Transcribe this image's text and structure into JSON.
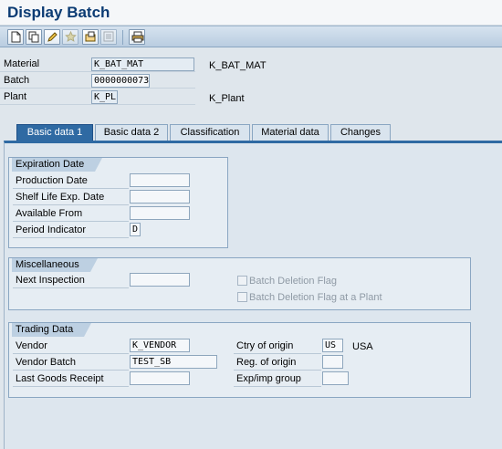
{
  "window": {
    "title": "Display Batch"
  },
  "toolbar": {
    "buttons": [
      {
        "icon": "new-document-icon",
        "enabled": true
      },
      {
        "icon": "copy-icon",
        "enabled": true
      },
      {
        "icon": "edit-pencil-icon",
        "enabled": true
      },
      {
        "icon": "star-icon",
        "enabled": false
      },
      {
        "icon": "open-icon",
        "enabled": true
      },
      {
        "icon": "other-object-icon",
        "enabled": false
      },
      {
        "icon": "print-icon",
        "enabled": true
      }
    ]
  },
  "header": {
    "material": {
      "label": "Material",
      "value": "K_BAT_MAT",
      "description": "K_BAT_MAT"
    },
    "batch": {
      "label": "Batch",
      "value": "0000000073"
    },
    "plant": {
      "label": "Plant",
      "value": "K_PL",
      "description": "K_Plant"
    }
  },
  "tabs": [
    {
      "label": "Basic data 1",
      "active": true
    },
    {
      "label": "Basic data 2",
      "active": false
    },
    {
      "label": "Classification",
      "active": false
    },
    {
      "label": "Material data",
      "active": false
    },
    {
      "label": "Changes",
      "active": false
    }
  ],
  "expiration": {
    "title": "Expiration Date",
    "production_date": {
      "label": "Production Date",
      "value": ""
    },
    "shelf_life": {
      "label": "Shelf Life Exp. Date",
      "value": ""
    },
    "available_from": {
      "label": "Available From",
      "value": ""
    },
    "period_indicator": {
      "label": "Period Indicator",
      "value": "D"
    }
  },
  "misc": {
    "title": "Miscellaneous",
    "next_inspection": {
      "label": "Next Inspection",
      "value": ""
    },
    "batch_deletion": {
      "label": "Batch Deletion Flag",
      "checked": false
    },
    "batch_deletion_plant": {
      "label": "Batch Deletion Flag at a Plant",
      "checked": false
    }
  },
  "trading": {
    "title": "Trading Data",
    "vendor": {
      "label": "Vendor",
      "value": "K_VENDOR"
    },
    "vendor_batch": {
      "label": "Vendor Batch",
      "value": "TEST_SB"
    },
    "last_goods_receipt": {
      "label": "Last Goods Receipt",
      "value": ""
    },
    "country_origin": {
      "label": "Ctry of origin",
      "value": "US",
      "description": "USA"
    },
    "region_origin": {
      "label": "Reg. of origin",
      "value": ""
    },
    "exp_imp_group": {
      "label": "Exp/imp group",
      "value": ""
    }
  },
  "colors": {
    "title": "#0b3b73",
    "active_tab": "#2f6aa3",
    "panel": "#dde6ee"
  }
}
